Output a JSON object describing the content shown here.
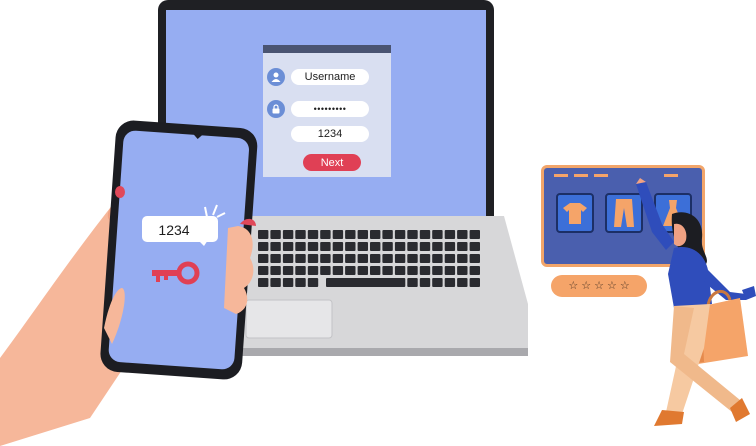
{
  "login": {
    "username_label": "Username",
    "password_mask": "•••••••••",
    "code_value": "1234",
    "next_label": "Next"
  },
  "phone": {
    "sms_code": "1234"
  },
  "shop": {
    "rating_stars": [
      "☆",
      "☆",
      "☆",
      "☆",
      "☆"
    ],
    "products": [
      "tshirt-icon",
      "pants-icon",
      "dress-icon"
    ]
  },
  "colors": {
    "screen_blue": "#96adf2",
    "accent_red": "#e04055",
    "accent_orange": "#f5a469",
    "laptop_dark": "#1f2024"
  }
}
